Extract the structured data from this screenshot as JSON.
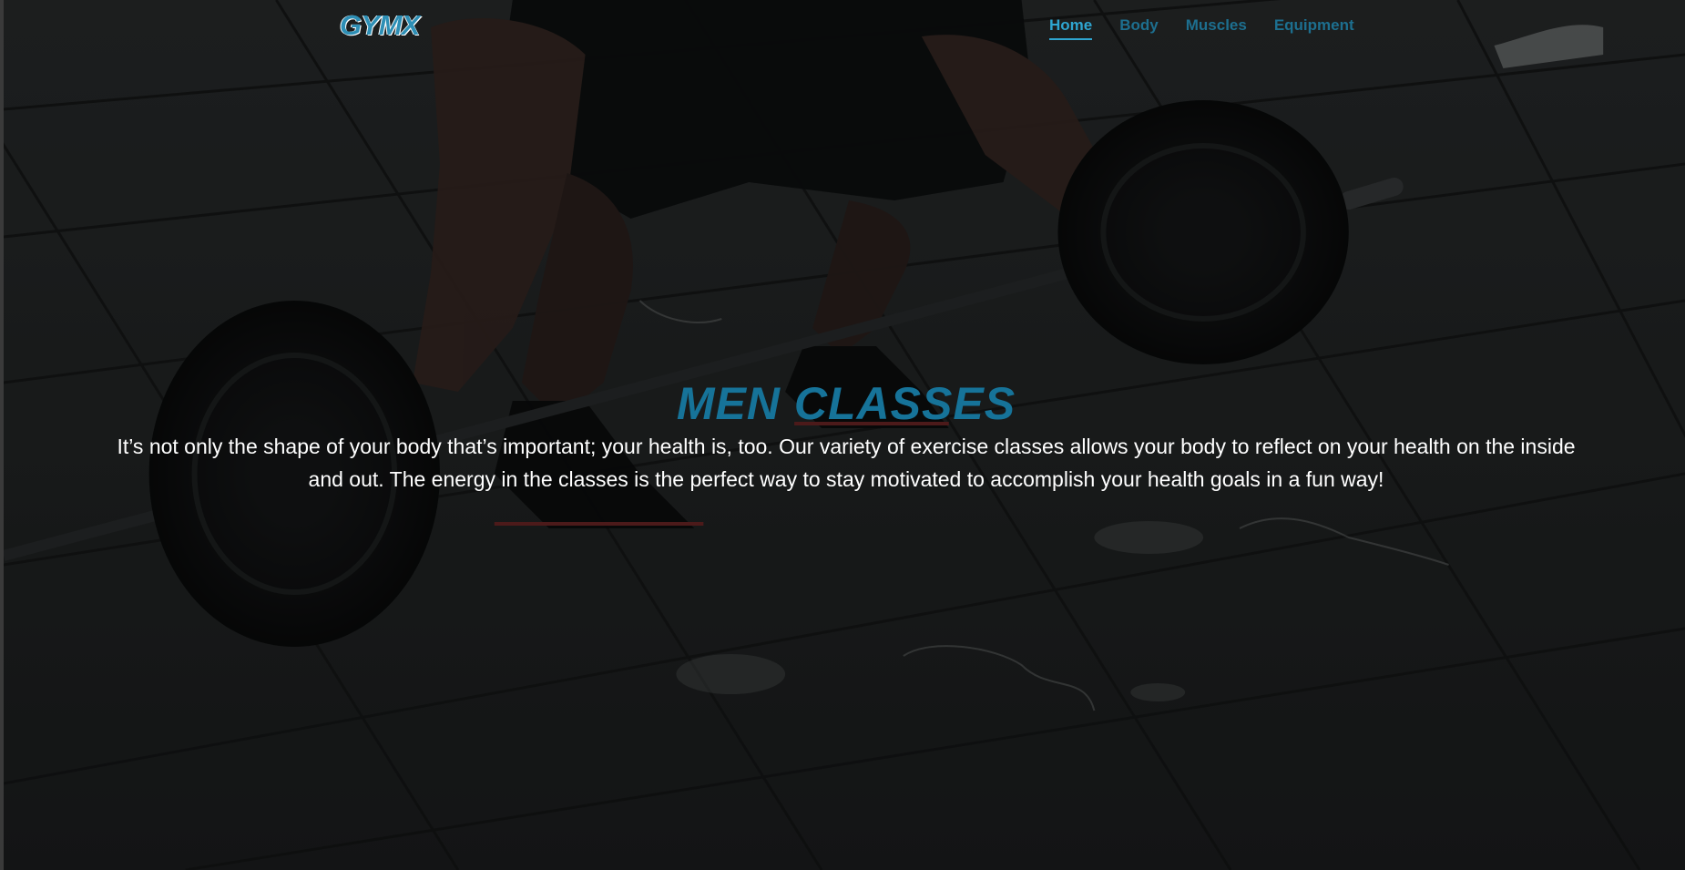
{
  "brand": {
    "logo_text": "GYMX",
    "accent_color": "#2ea5d0",
    "title_color": "#167399"
  },
  "nav": {
    "items": [
      {
        "label": "Home",
        "active": true
      },
      {
        "label": "Body",
        "active": false
      },
      {
        "label": "Muscles",
        "active": false
      },
      {
        "label": "Equipment",
        "active": false
      }
    ]
  },
  "hero": {
    "background_image": "weightlifter-deadlift-photo",
    "title": "MEN CLASSES",
    "text": "It’s not only the shape of your body that’s important; your health is, too. Our variety of exercise classes allows your body to reflect on your health on the inside and out. The energy in the classes is the perfect way to stay motivated to accomplish your health goals in a fun way!"
  }
}
